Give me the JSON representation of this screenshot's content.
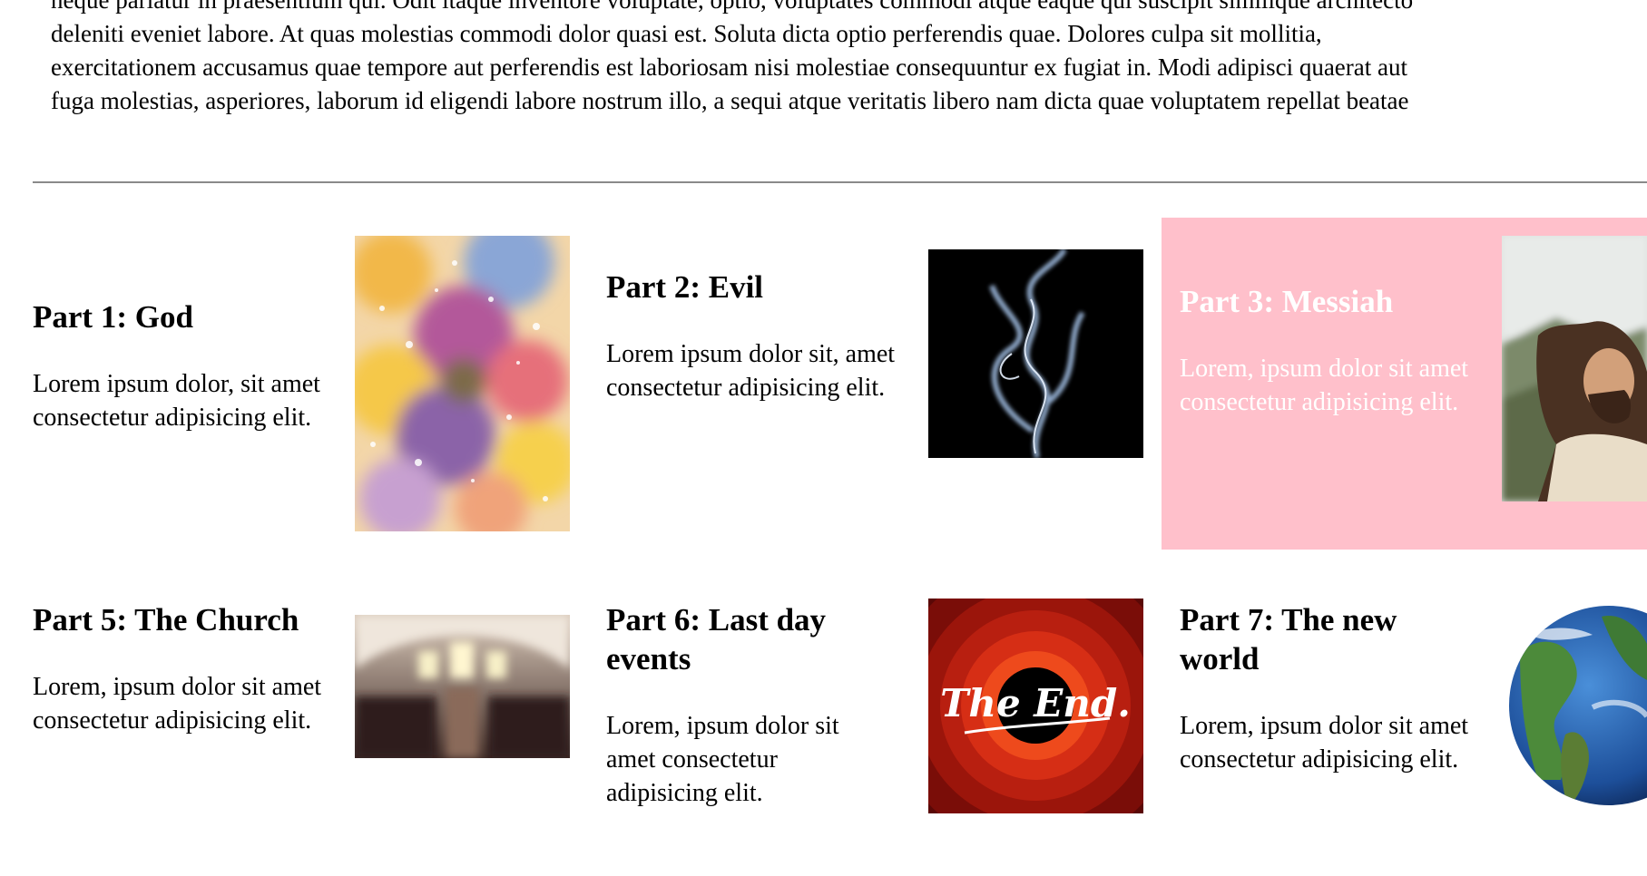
{
  "intro": {
    "lines": [
      "neque pariatur in praesentium qui. Odit itaque inventore voluptate, optio, voluptates commodi atque eaque qui suscipit similique architecto",
      "deleniti eveniet labore. At quas molestias commodi dolor quasi est. Soluta dicta optio perferendis quae. Dolores culpa sit mollitia,",
      "exercitationem accusamus quae tempore aut perferendis est laboriosam nisi molestiae consequuntur ex fugiat in. Modi adipisci quaerat aut",
      "fuga molestias, asperiores, laborum id eligendi labore nostrum illo, a sequi atque veritatis libero nam dicta quae voluptatem repellat beatae"
    ]
  },
  "parts": [
    {
      "title": "Part 1: God",
      "text": "Lorem ipsum dolor, sit amet consectetur adipisicing elit.",
      "image": "watercolor-image"
    },
    {
      "title": "Part 2: Evil",
      "text": "Lorem ipsum dolor sit, amet consectetur adipisicing elit.",
      "image": "smoke-image"
    },
    {
      "title": "Part 3: Messiah",
      "text": "Lorem, ipsum dolor sit amet consectetur adipisicing elit.",
      "image": "jesus-painting-image",
      "highlight_color": "#ffc0cb"
    },
    {
      "title": "Part 5: The Church",
      "text": "Lorem, ipsum dolor sit amet consectetur adipisicing elit.",
      "image": "church-interior-image"
    },
    {
      "title": "Part 6: Last day events",
      "text": "Lorem, ipsum dolor sit amet consectetur adipisicing elit.",
      "image": "the-end-image",
      "image_text": "The End."
    },
    {
      "title": "Part 7: The new world",
      "text": "Lorem, ipsum dolor sit amet consectetur adipisicing elit.",
      "image": "earth-globe-image"
    }
  ]
}
